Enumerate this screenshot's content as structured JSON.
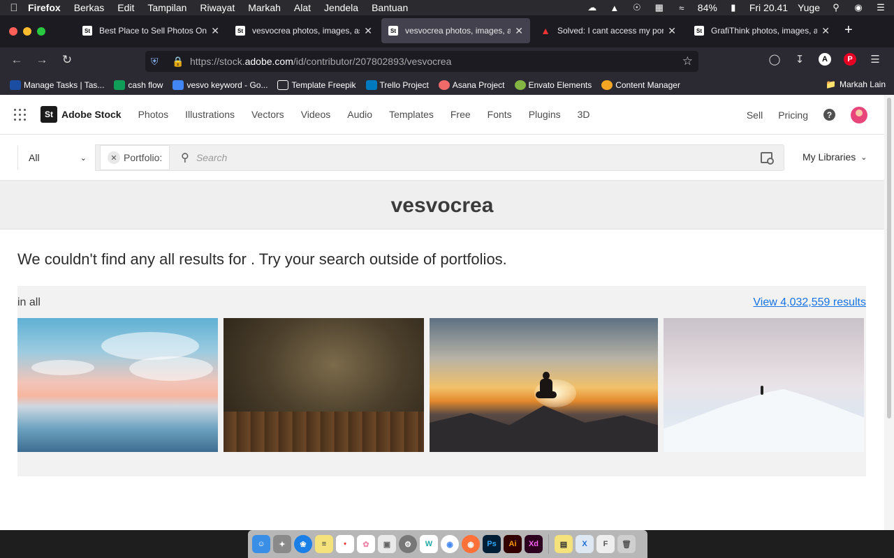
{
  "menubar": {
    "apple": "",
    "items": [
      "Firefox",
      "Berkas",
      "Edit",
      "Tampilan",
      "Riwayat",
      "Markah",
      "Alat",
      "Jendela",
      "Bantuan"
    ],
    "battery": "84%",
    "time": "Fri 20.41",
    "user": "Yuge"
  },
  "tabs": [
    {
      "favicon": "St",
      "title": "Best Place to Sell Photos Online",
      "active": false
    },
    {
      "favicon": "St",
      "title": "vesvocrea photos, images, assets",
      "active": false
    },
    {
      "favicon": "St",
      "title": "vesvocrea photos, images, assets",
      "active": true
    },
    {
      "favicon": "adobe-icon",
      "title": "Solved: I cant access my portfolio",
      "active": false
    },
    {
      "favicon": "St",
      "title": "GrafiThink photos, images, assets",
      "active": false
    }
  ],
  "address": {
    "url_prefix": "https://stock.",
    "url_domain": "adobe.com",
    "url_path": "/id/contributor/207802893/vesvocrea"
  },
  "nav_toolbar": {
    "account_letter": "A",
    "pinterest_letter": "P"
  },
  "bookmarks": [
    {
      "label": "Manage Tasks | Tas...",
      "color": "#1b4ea3"
    },
    {
      "label": "cash flow",
      "color": "#0f9d58"
    },
    {
      "label": "vesvo keyword - Go...",
      "color": "#4285f4"
    },
    {
      "label": "Template Freepik",
      "color": "#2b2a33"
    },
    {
      "label": "Trello Project",
      "color": "#0079bf"
    },
    {
      "label": "Asana Project",
      "color": "#f06a6a"
    },
    {
      "label": "Envato Elements",
      "color": "#82b541"
    },
    {
      "label": "Content Manager",
      "color": "#f5a623"
    }
  ],
  "bookmarks_other": "Markah Lain",
  "adobe_stock": {
    "logo_mark": "St",
    "brand": "Adobe Stock",
    "nav": [
      "Photos",
      "Illustrations",
      "Vectors",
      "Videos",
      "Audio",
      "Templates",
      "Free",
      "Fonts",
      "Plugins",
      "3D"
    ],
    "sell": "Sell",
    "pricing": "Pricing",
    "help_glyph": "?"
  },
  "search": {
    "filter_value": "All",
    "chip_label": "Portfolio:",
    "placeholder": "Search",
    "my_libraries": "My Libraries"
  },
  "portfolio": {
    "title": "vesvocrea",
    "no_results": "We couldn't find any all results for . Try your search outside of portfolios.",
    "in_all_label": "in all",
    "view_results": "View 4,032,559 results"
  },
  "thumbnails": [
    {
      "subject": "Sunset beach with clouds"
    },
    {
      "subject": "Grunge wooden room"
    },
    {
      "subject": "Meditation on mountain at sunset"
    },
    {
      "subject": "Hiker on snowy mountain"
    }
  ],
  "dock_apps": [
    "Finder",
    "Launchpad",
    "Safari",
    "Notes",
    "Reminders",
    "Photos",
    "Preview",
    "System Preferences",
    "Wunderlist",
    "Chrome",
    "Firefox",
    "Photoshop",
    "Illustrator",
    "XD",
    "Stickies",
    "Xcode",
    "Font Book",
    "Trash"
  ]
}
